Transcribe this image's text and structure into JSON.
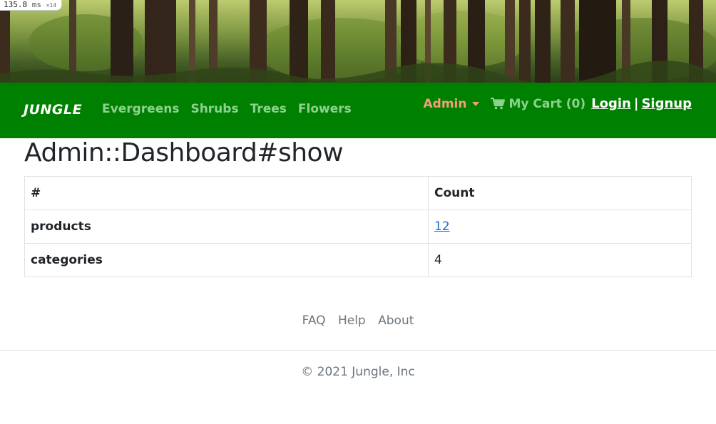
{
  "perf": {
    "time": "135.8",
    "unit": "ms",
    "multiplier": "×14"
  },
  "nav": {
    "brand": "JUNGLE",
    "links": [
      "Evergreens",
      "Shrubs",
      "Trees",
      "Flowers"
    ],
    "admin_label": "Admin",
    "cart_label": "My Cart (0)",
    "login_label": "Login",
    "separator": "|",
    "signup_label": "Signup",
    "colors": {
      "navbar": "#008000",
      "link": "#8fd18f",
      "admin": "#f3a07a"
    }
  },
  "main": {
    "title": "Admin::Dashboard#show",
    "table": {
      "headers": [
        "#",
        "Count"
      ],
      "rows": [
        {
          "label": "products",
          "count": "12"
        },
        {
          "label": "categories",
          "count": "4"
        }
      ]
    }
  },
  "footer": {
    "links": [
      "FAQ",
      "Help",
      "About"
    ],
    "copyright": "© 2021 Jungle, Inc"
  },
  "icons": {
    "cart": "shopping-cart-icon",
    "admin_caret": "caret-down-icon"
  }
}
